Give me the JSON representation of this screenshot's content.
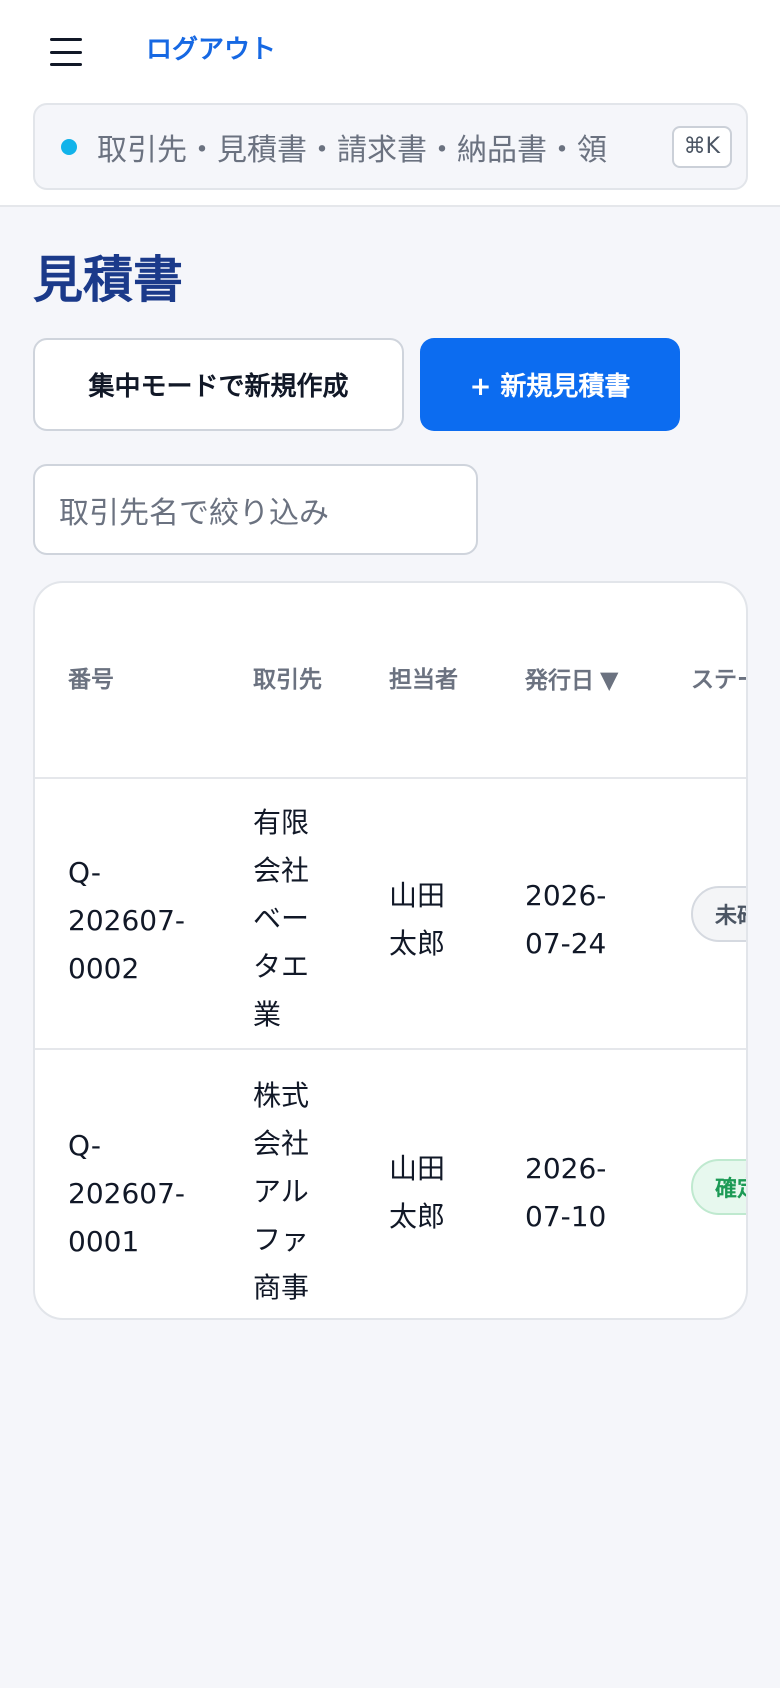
{
  "header": {
    "logout_label": "ログアウト",
    "search": {
      "placeholder": "取引先・見積書・請求書・納品書・領",
      "shortcut": "⌘K"
    }
  },
  "page": {
    "title": "見積書",
    "focus_create_label": "集中モードで新規作成",
    "new_quote_label": "+ 新規見積書",
    "filter_placeholder": "取引先名で絞り込み"
  },
  "table": {
    "columns": {
      "number": "番号",
      "client": "取引先",
      "owner": "担当者",
      "issue_date": "発行日",
      "issue_date_sort": "▼",
      "status": "ステー"
    },
    "rows": [
      {
        "number": "Q-\n202607-\n0002",
        "client": "有限\n会社\nベー\nタエ\n業",
        "owner": "山田\n太郎",
        "issue_date": "2026-\n07-24",
        "status": "未確"
      },
      {
        "number": "Q-\n202607-\n0001",
        "client": "株式\n会社\nアル\nファ\n商事",
        "owner": "山田\n太郎",
        "issue_date": "2026-\n07-10",
        "status": "確定"
      }
    ]
  },
  "colors": {
    "accent": "#0c6cf0",
    "title": "#1b3a8a",
    "status_dot": "#12b3ea",
    "confirmed": "#1c9a55"
  }
}
